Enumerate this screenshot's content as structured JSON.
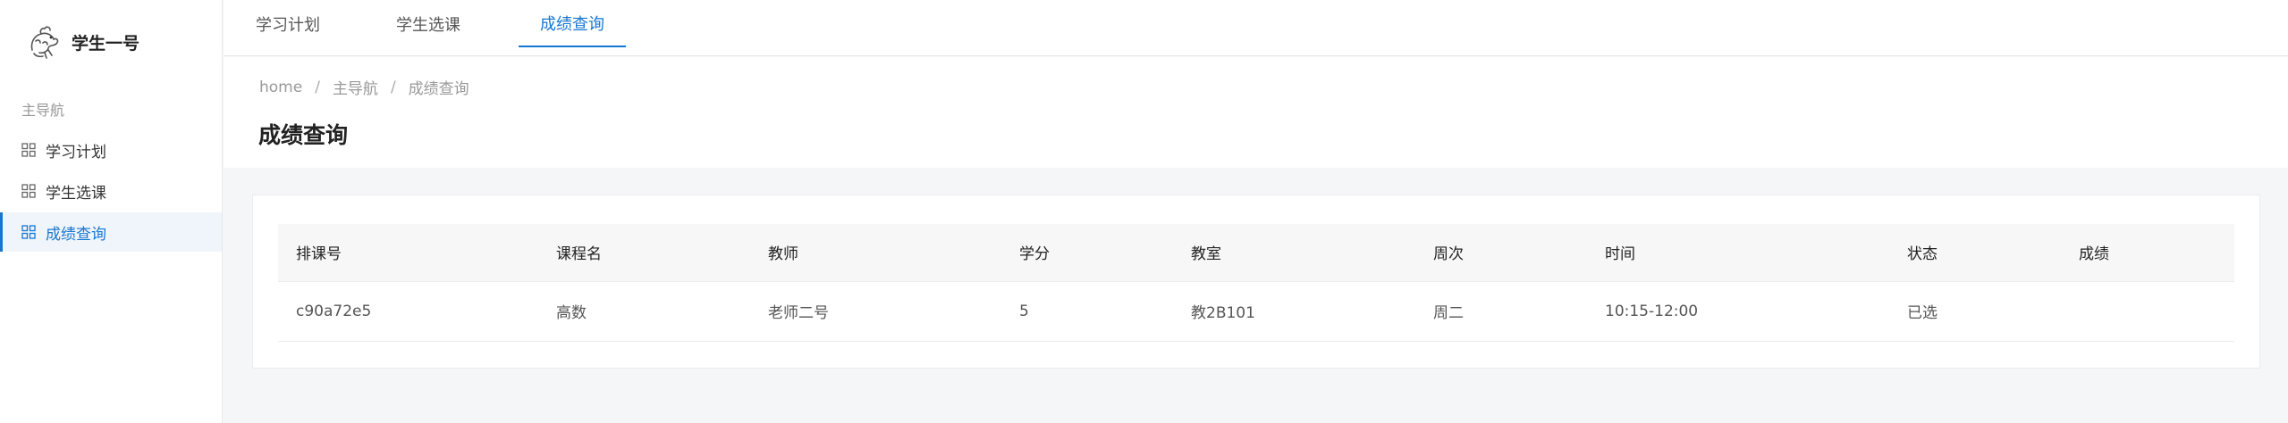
{
  "brand": {
    "name": "学生一号",
    "logo_icon": "dragon-logo-icon"
  },
  "sidebar": {
    "group_label": "主导航",
    "items": [
      {
        "label": "学习计划",
        "icon": "grid-icon",
        "active": false
      },
      {
        "label": "学生选课",
        "icon": "grid-icon",
        "active": false
      },
      {
        "label": "成绩查询",
        "icon": "grid-icon",
        "active": true
      }
    ]
  },
  "tabs": [
    {
      "label": "学习计划",
      "active": false
    },
    {
      "label": "学生选课",
      "active": false
    },
    {
      "label": "成绩查询",
      "active": true
    }
  ],
  "breadcrumb": [
    "home",
    "主导航",
    "成绩查询"
  ],
  "breadcrumb_separator": "/",
  "page_title": "成绩查询",
  "table": {
    "columns": [
      "排课号",
      "课程名",
      "教师",
      "学分",
      "教室",
      "周次",
      "时间",
      "状态",
      "成绩"
    ],
    "rows": [
      [
        "c90a72e5",
        "高数",
        "老师二号",
        "5",
        "教2B101",
        "周二",
        "10:15-12:00",
        "已选",
        ""
      ]
    ]
  },
  "colors": {
    "accent": "#1677d2",
    "background": "#f5f6f8",
    "surface": "#ffffff"
  }
}
